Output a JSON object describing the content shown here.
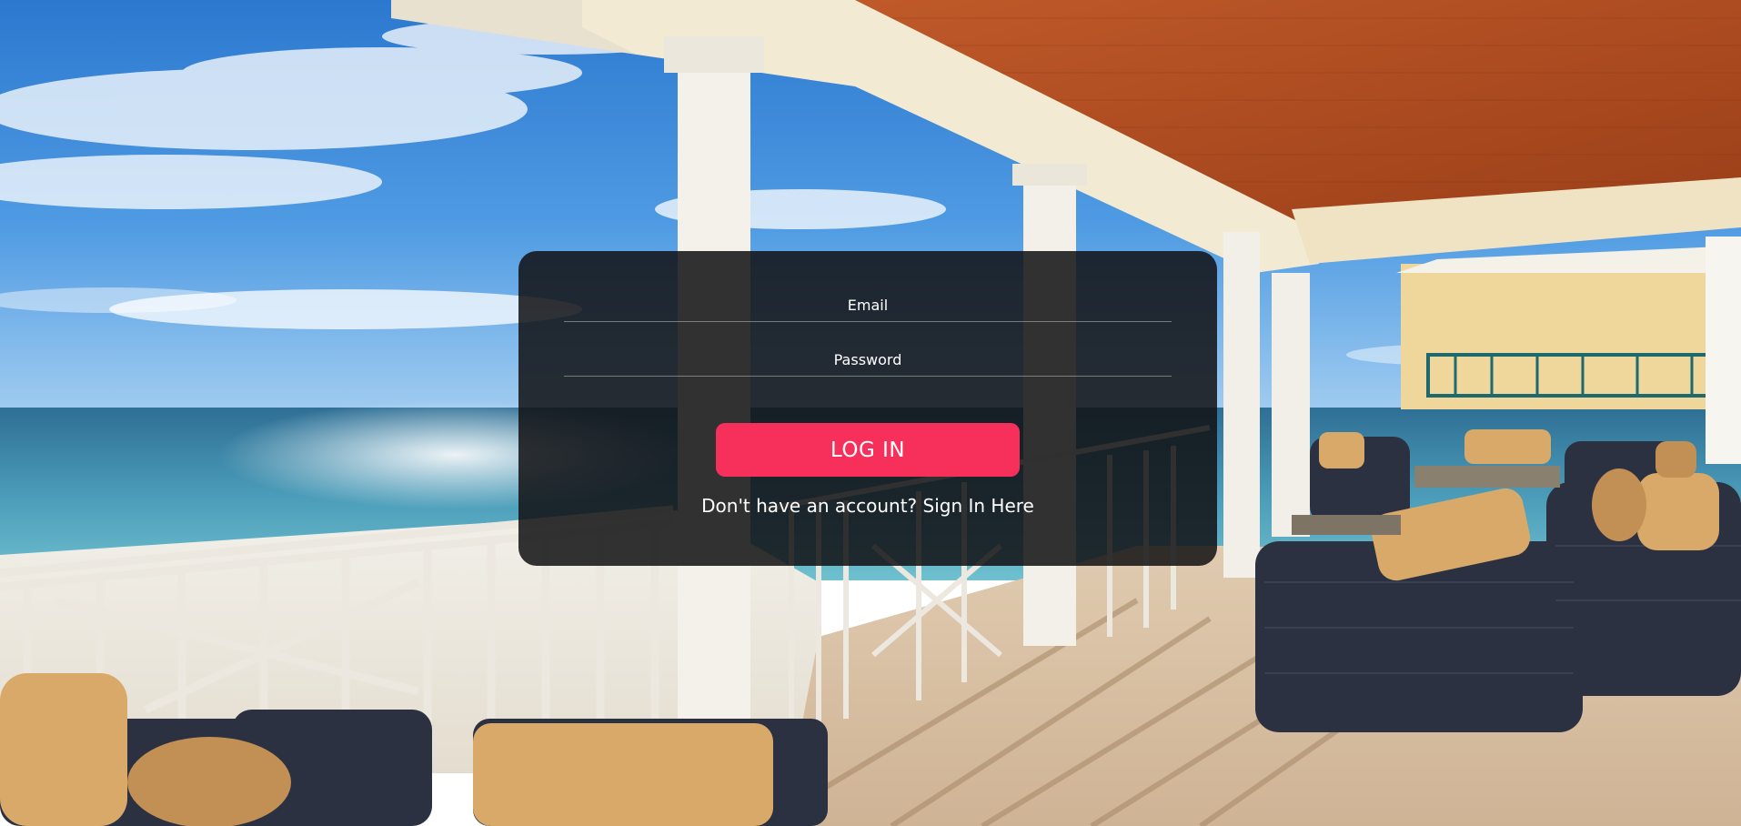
{
  "login": {
    "email_placeholder": "Email",
    "password_placeholder": "Password",
    "login_label": "LOG IN",
    "signup_prompt": "Don't have an account?",
    "signup_link": "Sign In Here"
  },
  "colors": {
    "button": "#f6305a",
    "panel": "rgba(18,18,20,0.86)"
  }
}
